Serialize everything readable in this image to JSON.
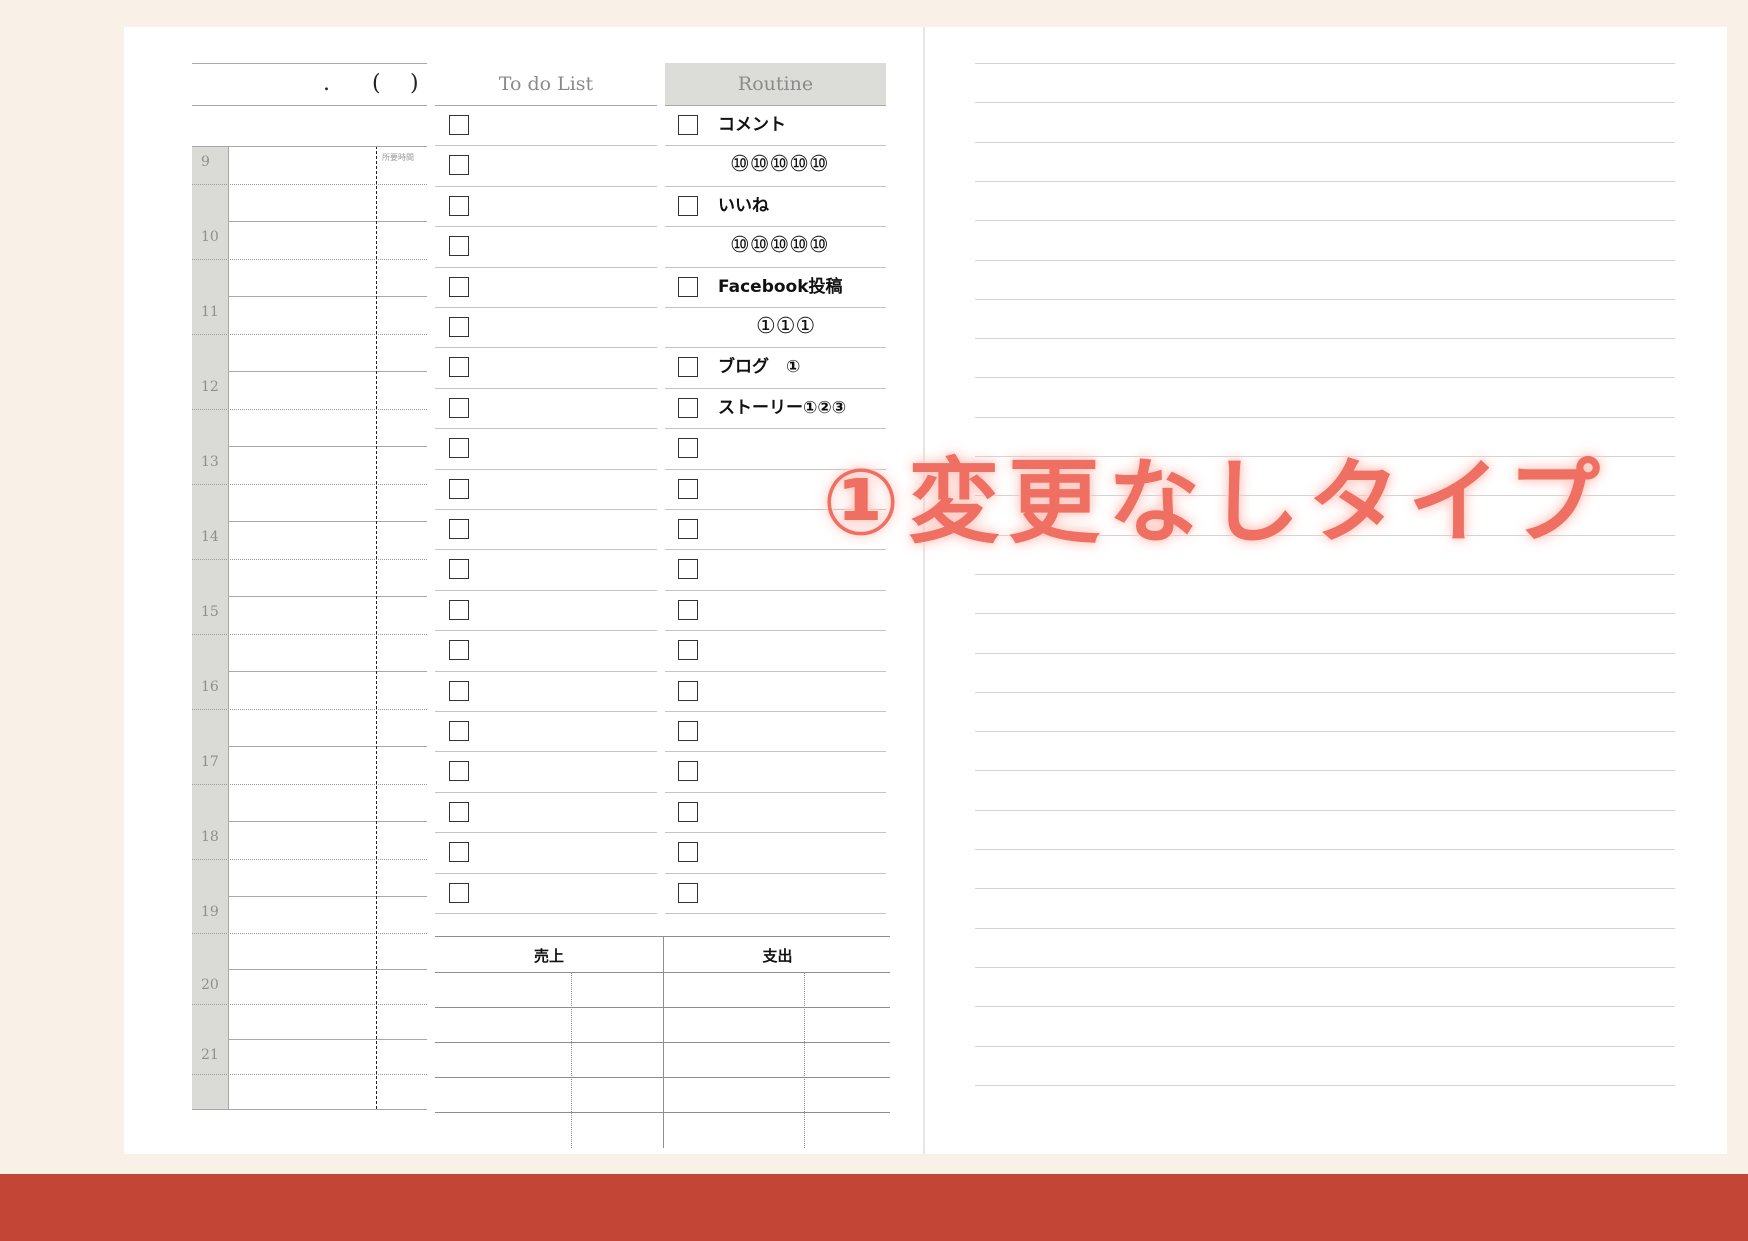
{
  "date": {
    "dot": ".",
    "paren_open": "(",
    "paren_close": ")"
  },
  "timeline": {
    "hours": [
      "9",
      "10",
      "11",
      "12",
      "13",
      "14",
      "15",
      "16",
      "17",
      "18",
      "19",
      "20",
      "21"
    ],
    "duration_label": "所要時間"
  },
  "todo": {
    "header": "To do List",
    "checkbox_count": 20
  },
  "routine": {
    "header": "Routine",
    "checkbox_count": 20,
    "rows": [
      {
        "checkbox": true,
        "text": "コメント"
      },
      {
        "checkbox": false,
        "text": "⑩⑩⑩⑩⑩"
      },
      {
        "checkbox": true,
        "text": "いいね"
      },
      {
        "checkbox": false,
        "text": "⑩⑩⑩⑩⑩"
      },
      {
        "checkbox": true,
        "text": "Facebook投稿"
      },
      {
        "checkbox": false,
        "text": "①①①"
      },
      {
        "checkbox": true,
        "text": "ブログ　①"
      },
      {
        "checkbox": true,
        "text": "ストーリー①②③"
      }
    ]
  },
  "ledger": {
    "sales_label": "売上",
    "expense_label": "支出"
  },
  "overlay": {
    "text": "①変更なしタイプ"
  },
  "colors": {
    "accent_band": "#c24535",
    "header_fill": "#dcddd8",
    "watermark": "#ef6f63"
  }
}
